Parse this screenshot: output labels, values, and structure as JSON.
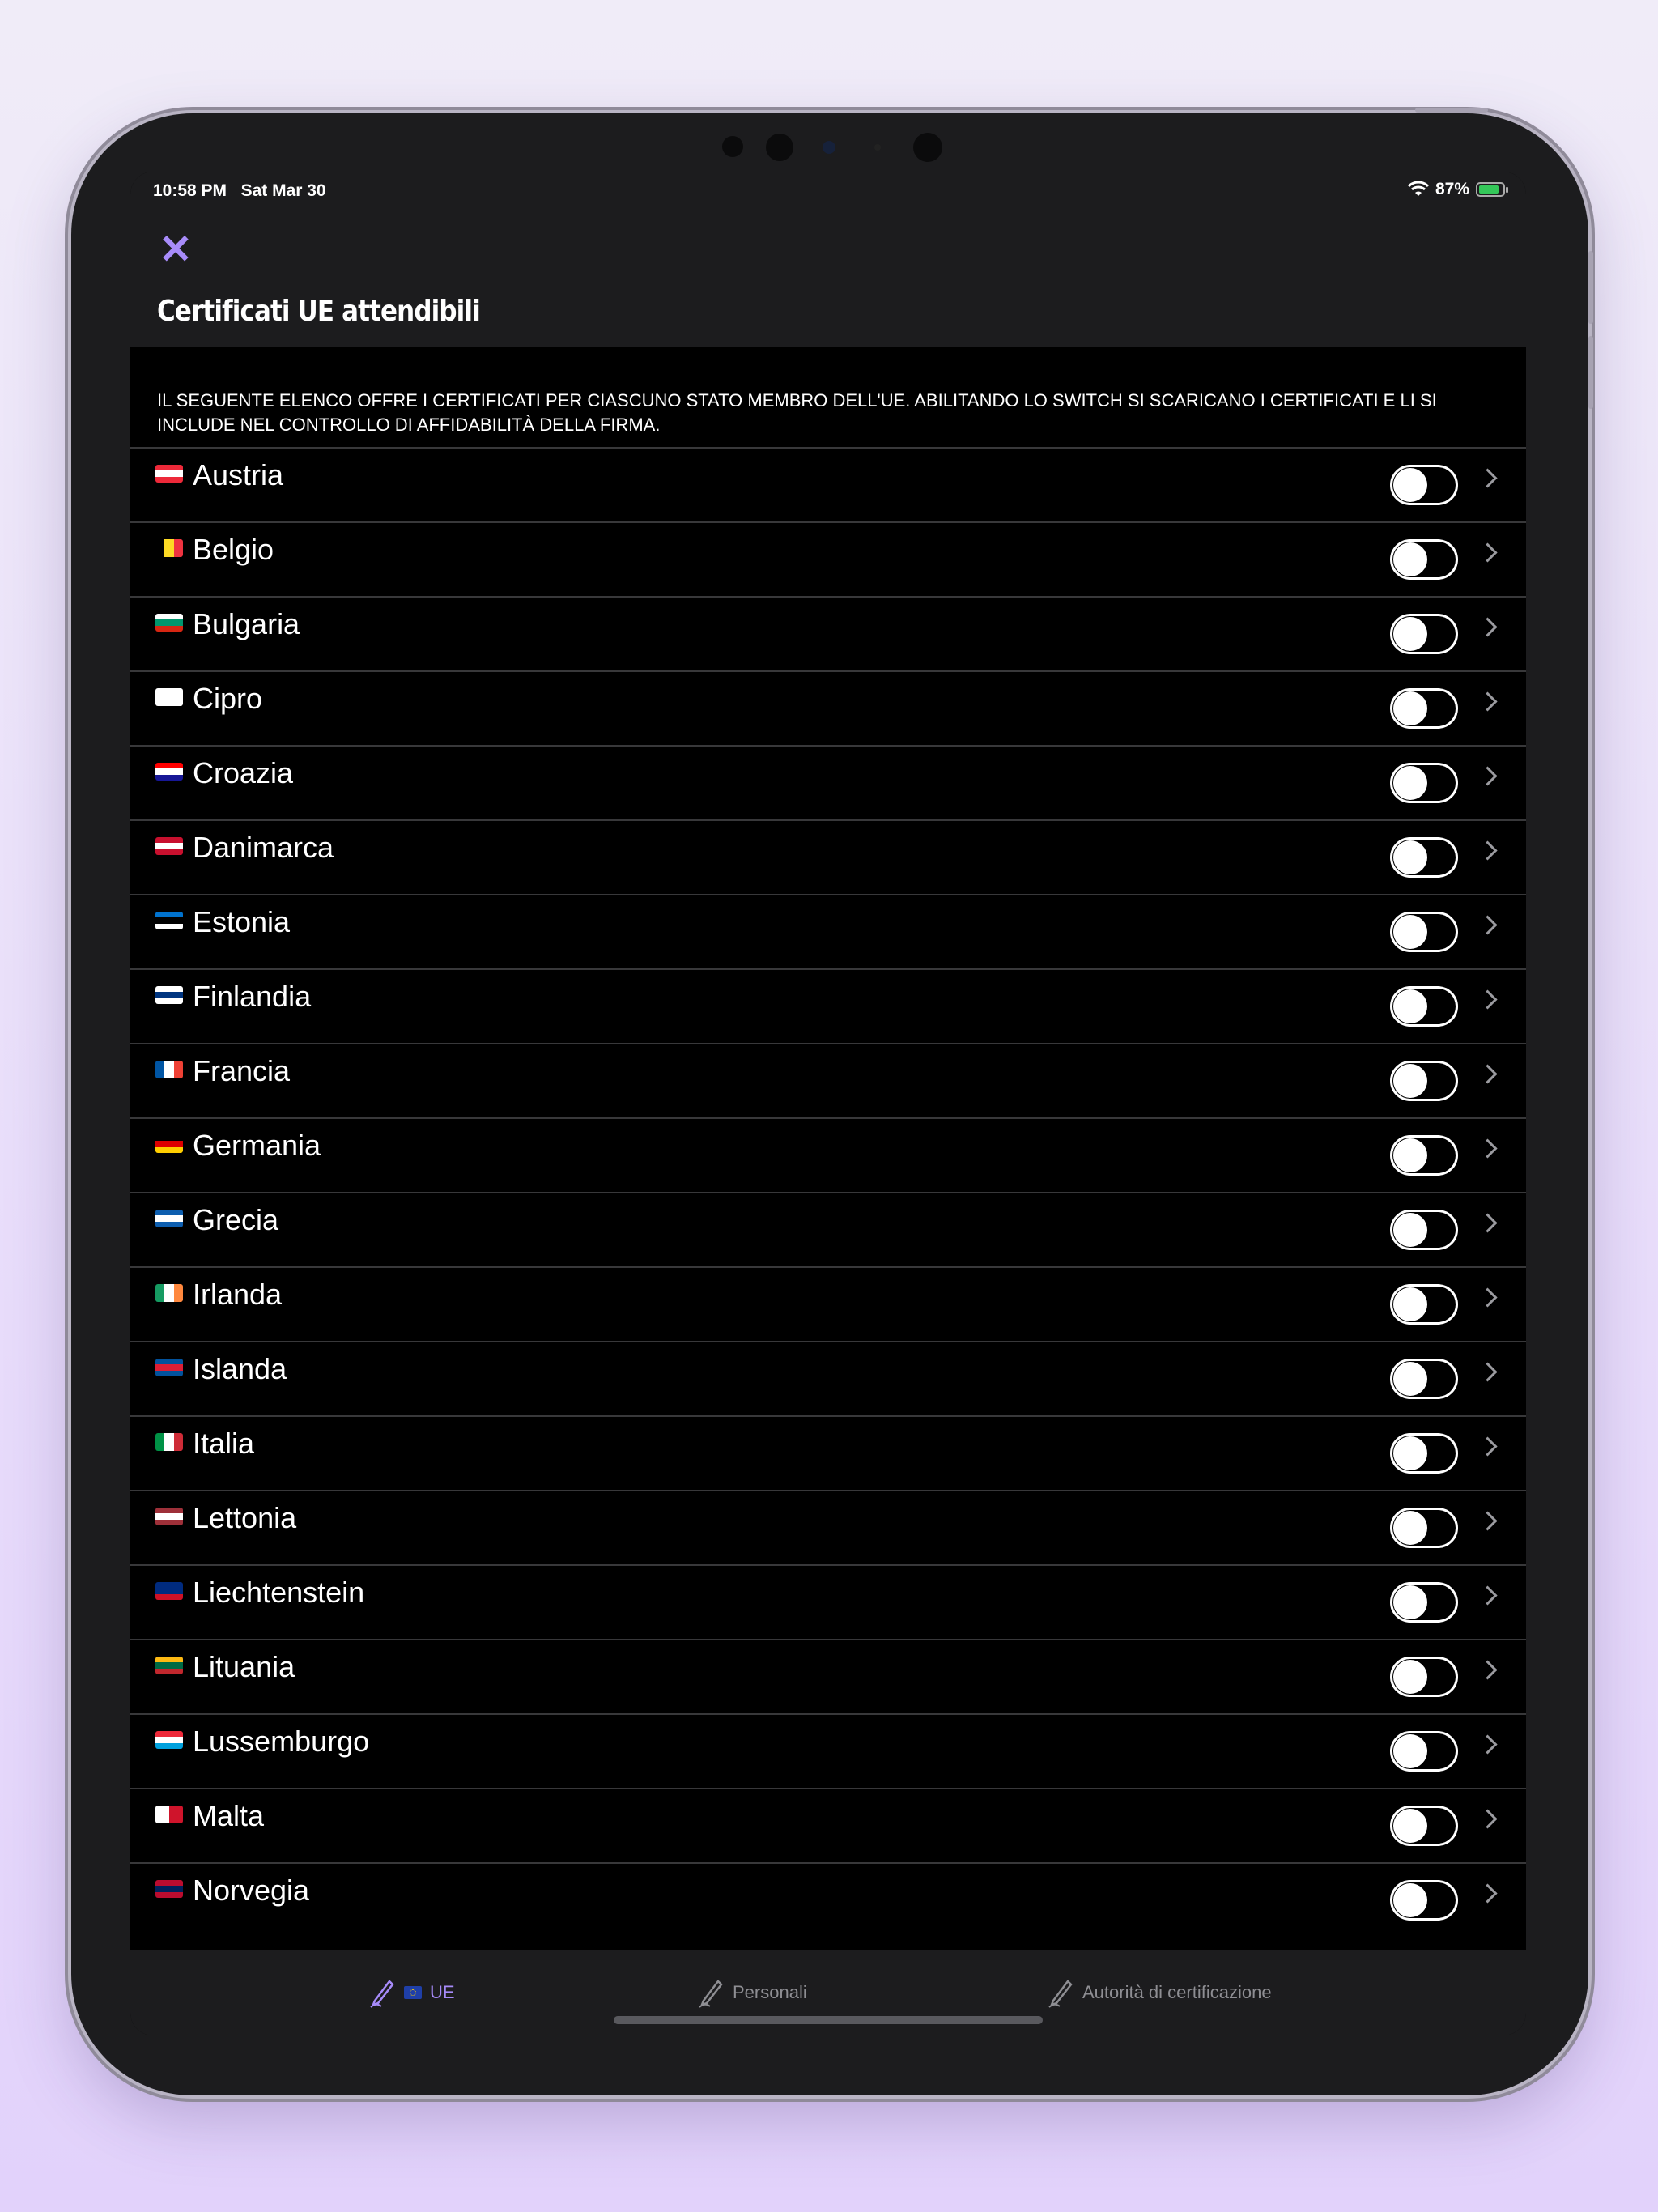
{
  "status": {
    "time": "10:58 PM",
    "date": "Sat Mar 30",
    "battery": "87%",
    "battery_level": 0.87
  },
  "nav": {
    "close_symbol": "✕",
    "title": "Certificati UE attendibili"
  },
  "section": {
    "text": "IL SEGUENTE ELENCO OFFRE I CERTIFICATI PER CIASCUNO STATO MEMBRO DELL'UE. ABILITANDO LO SWITCH SI SCARICANO I CERTIFICATI E LI SI INCLUDE NEL CONTROLLO DI AFFIDABILITÀ DELLA FIRMA."
  },
  "countries": [
    {
      "name": "Austria",
      "enabled": false,
      "flag": [
        "#ed2939",
        "#ffffff",
        "#ed2939"
      ],
      "dir": "h"
    },
    {
      "name": "Belgio",
      "enabled": false,
      "flag": [
        "#000000",
        "#fdda24",
        "#ef3340"
      ],
      "dir": "v"
    },
    {
      "name": "Bulgaria",
      "enabled": false,
      "flag": [
        "#ffffff",
        "#00966e",
        "#d62612"
      ],
      "dir": "h"
    },
    {
      "name": "Cipro",
      "enabled": false,
      "flag": [
        "#ffffff",
        "#ffffff",
        "#ffffff"
      ],
      "dir": "h"
    },
    {
      "name": "Croazia",
      "enabled": false,
      "flag": [
        "#ff0000",
        "#ffffff",
        "#171796"
      ],
      "dir": "h"
    },
    {
      "name": "Danimarca",
      "enabled": false,
      "flag": [
        "#c8102e",
        "#ffffff",
        "#c8102e"
      ],
      "dir": "h"
    },
    {
      "name": "Estonia",
      "enabled": false,
      "flag": [
        "#0072ce",
        "#000000",
        "#ffffff"
      ],
      "dir": "h"
    },
    {
      "name": "Finlandia",
      "enabled": false,
      "flag": [
        "#ffffff",
        "#003580",
        "#ffffff"
      ],
      "dir": "h"
    },
    {
      "name": "Francia",
      "enabled": false,
      "flag": [
        "#0055a4",
        "#ffffff",
        "#ef4135"
      ],
      "dir": "v"
    },
    {
      "name": "Germania",
      "enabled": false,
      "flag": [
        "#000000",
        "#dd0000",
        "#ffce00"
      ],
      "dir": "h"
    },
    {
      "name": "Grecia",
      "enabled": false,
      "flag": [
        "#0d5eaf",
        "#ffffff",
        "#0d5eaf"
      ],
      "dir": "h"
    },
    {
      "name": "Irlanda",
      "enabled": false,
      "flag": [
        "#169b62",
        "#ffffff",
        "#ff883e"
      ],
      "dir": "v"
    },
    {
      "name": "Islanda",
      "enabled": false,
      "flag": [
        "#02529c",
        "#dc1e35",
        "#02529c"
      ],
      "dir": "h"
    },
    {
      "name": "Italia",
      "enabled": false,
      "flag": [
        "#009246",
        "#ffffff",
        "#ce2b37"
      ],
      "dir": "v"
    },
    {
      "name": "Lettonia",
      "enabled": false,
      "flag": [
        "#9e3039",
        "#ffffff",
        "#9e3039"
      ],
      "dir": "h"
    },
    {
      "name": "Liechtenstein",
      "enabled": false,
      "flag": [
        "#002b7f",
        "#002b7f",
        "#ce1126"
      ],
      "dir": "h"
    },
    {
      "name": "Lituania",
      "enabled": false,
      "flag": [
        "#fdb913",
        "#006a44",
        "#c1272d"
      ],
      "dir": "h"
    },
    {
      "name": "Lussemburgo",
      "enabled": false,
      "flag": [
        "#ed2939",
        "#ffffff",
        "#00a1de"
      ],
      "dir": "h"
    },
    {
      "name": "Malta",
      "enabled": false,
      "flag": [
        "#ffffff",
        "#cf142b"
      ],
      "dir": "v"
    },
    {
      "name": "Norvegia",
      "enabled": false,
      "flag": [
        "#ba0c2f",
        "#00205b",
        "#ba0c2f"
      ],
      "dir": "h"
    }
  ],
  "tabs": [
    {
      "label": "UE",
      "icon": "signature-pen-icon",
      "active": true
    },
    {
      "label": "Personali",
      "icon": "signature-pen-icon",
      "active": false
    },
    {
      "label": "Autorità di certificazione",
      "icon": "signature-pen-icon",
      "active": false
    }
  ],
  "colors": {
    "accent": "#a78bfa",
    "background": "#000000",
    "bar": "#1c1c1e",
    "separator": "#38383a"
  }
}
